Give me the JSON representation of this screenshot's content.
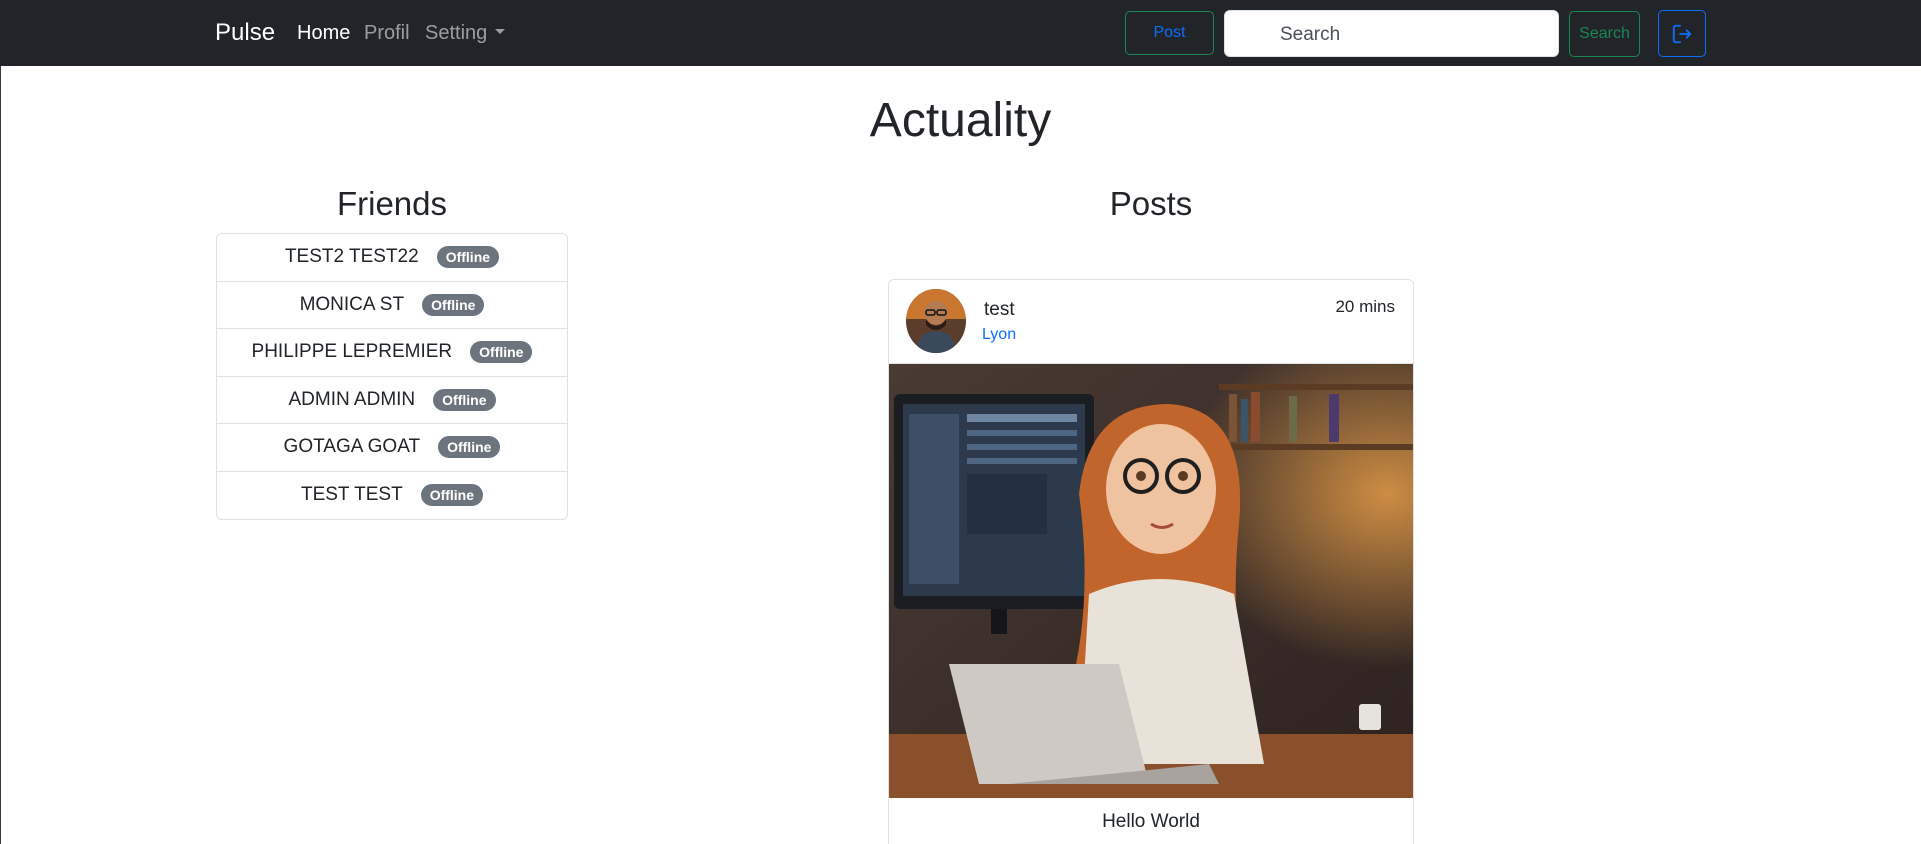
{
  "navbar": {
    "brand": "Pulse",
    "links": [
      "Home",
      "Profil",
      "Setting"
    ],
    "post_button": "Post",
    "search_placeholder": "Search",
    "search_button": "Search",
    "logout_icon": "logout-icon"
  },
  "main": {
    "title": "Actuality",
    "friends_title": "Friends",
    "posts_title": "Posts"
  },
  "friends": [
    {
      "name": "TEST2 TEST22",
      "status": "Offline"
    },
    {
      "name": "MONICA ST",
      "status": "Offline"
    },
    {
      "name": "PHILIPPE LEPREMIER",
      "status": "Offline"
    },
    {
      "name": "ADMIN ADMIN",
      "status": "Offline"
    },
    {
      "name": "GOTAGA GOAT",
      "status": "Offline"
    },
    {
      "name": "TEST TEST",
      "status": "Offline"
    }
  ],
  "post": {
    "user": "test",
    "location": "Lyon",
    "time": "20 mins",
    "text": "Hello World"
  },
  "colors": {
    "navbar_bg": "#212529",
    "primary": "#0d6efd",
    "success": "#198754",
    "badge": "#6c757d"
  }
}
